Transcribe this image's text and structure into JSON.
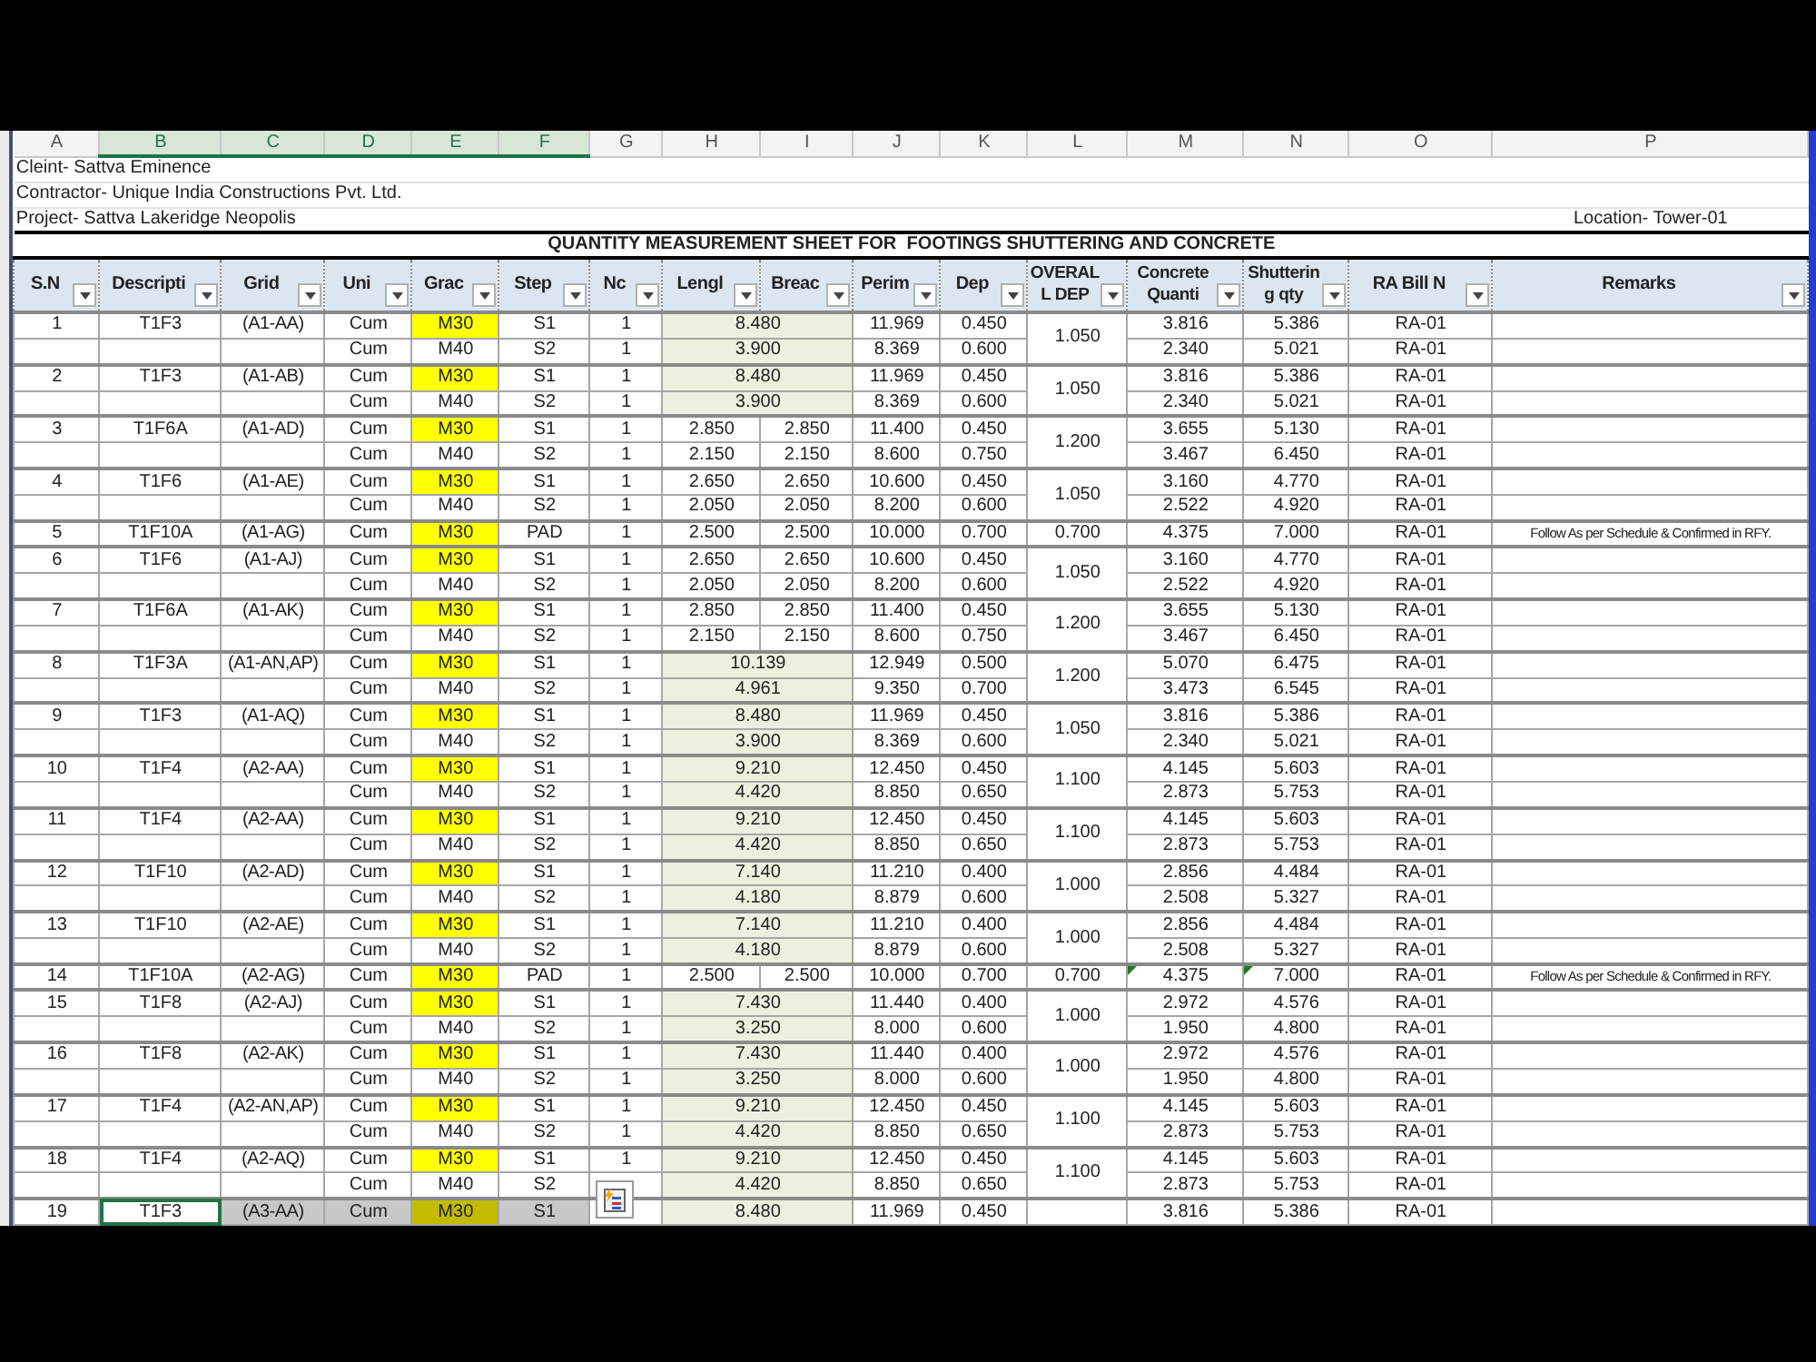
{
  "columns": [
    {
      "letter": "A",
      "selected": false
    },
    {
      "letter": "B",
      "selected": true
    },
    {
      "letter": "C",
      "selected": true
    },
    {
      "letter": "D",
      "selected": true
    },
    {
      "letter": "E",
      "selected": true
    },
    {
      "letter": "F",
      "selected": true
    },
    {
      "letter": "G",
      "selected": false
    },
    {
      "letter": "H",
      "selected": false
    },
    {
      "letter": "I",
      "selected": false
    },
    {
      "letter": "J",
      "selected": false
    },
    {
      "letter": "K",
      "selected": false
    },
    {
      "letter": "L",
      "selected": false
    },
    {
      "letter": "M",
      "selected": false
    },
    {
      "letter": "N",
      "selected": false
    },
    {
      "letter": "O",
      "selected": false
    },
    {
      "letter": "P",
      "selected": false
    }
  ],
  "info_lines": [
    "Cleint- Sattva Eminence",
    "Contractor- Unique India Constructions Pvt. Ltd.",
    "Project- Sattva Lakeridge Neopolis"
  ],
  "location": "Location- Tower-01",
  "sheet_title": "QUANTITY MEASUREMENT SHEET FOR  FOOTINGS SHUTTERING AND CONCRETE",
  "headers": [
    {
      "lines": [
        "S.N"
      ]
    },
    {
      "lines": [
        "Descripti"
      ]
    },
    {
      "lines": [
        "Grid"
      ]
    },
    {
      "lines": [
        "Uni"
      ]
    },
    {
      "lines": [
        "Grac"
      ]
    },
    {
      "lines": [
        "Step"
      ]
    },
    {
      "lines": [
        "Nc"
      ]
    },
    {
      "lines": [
        "Lengl"
      ]
    },
    {
      "lines": [
        "Breac"
      ]
    },
    {
      "lines": [
        "Perim"
      ]
    },
    {
      "lines": [
        "Dep"
      ]
    },
    {
      "lines": [
        "OVERAL",
        "L DEP"
      ]
    },
    {
      "lines": [
        "Concrete",
        "Quanti"
      ]
    },
    {
      "lines": [
        "Shutterin",
        "g qty"
      ]
    },
    {
      "lines": [
        "RA Bill N"
      ]
    },
    {
      "lines": [
        "Remarks"
      ]
    }
  ],
  "footings": [
    {
      "sn": "1",
      "description": "T1F3",
      "grid": "(A1-AA)",
      "overall_depth": "1.050",
      "selected": false,
      "flagged": false,
      "steps": [
        {
          "unit": "Cum",
          "grade": "M30",
          "highlighted": true,
          "step": "S1",
          "nos": "1",
          "length": "8.480",
          "perimeter": "11.969",
          "depth": "0.450",
          "concrete": "3.816",
          "shuttering": "5.386",
          "ra_bill": "RA-01"
        },
        {
          "unit": "Cum",
          "grade": "M40",
          "highlighted": false,
          "step": "S2",
          "nos": "1",
          "length": "3.900",
          "perimeter": "8.369",
          "depth": "0.600",
          "concrete": "2.340",
          "shuttering": "5.021",
          "ra_bill": "RA-01"
        }
      ]
    },
    {
      "sn": "2",
      "description": "T1F3",
      "grid": "(A1-AB)",
      "overall_depth": "1.050",
      "selected": false,
      "flagged": false,
      "steps": [
        {
          "unit": "Cum",
          "grade": "M30",
          "highlighted": true,
          "step": "S1",
          "nos": "1",
          "length": "8.480",
          "perimeter": "11.969",
          "depth": "0.450",
          "concrete": "3.816",
          "shuttering": "5.386",
          "ra_bill": "RA-01"
        },
        {
          "unit": "Cum",
          "grade": "M40",
          "highlighted": false,
          "step": "S2",
          "nos": "1",
          "length": "3.900",
          "perimeter": "8.369",
          "depth": "0.600",
          "concrete": "2.340",
          "shuttering": "5.021",
          "ra_bill": "RA-01"
        }
      ]
    },
    {
      "sn": "3",
      "description": "T1F6A",
      "grid": "(A1-AD)",
      "overall_depth": "1.200",
      "selected": false,
      "flagged": false,
      "steps": [
        {
          "unit": "Cum",
          "grade": "M30",
          "highlighted": true,
          "step": "S1",
          "nos": "1",
          "length": "2.850",
          "breadth": "2.850",
          "perimeter": "11.400",
          "depth": "0.450",
          "concrete": "3.655",
          "shuttering": "5.130",
          "ra_bill": "RA-01"
        },
        {
          "unit": "Cum",
          "grade": "M40",
          "highlighted": false,
          "step": "S2",
          "nos": "1",
          "length": "2.150",
          "breadth": "2.150",
          "perimeter": "8.600",
          "depth": "0.750",
          "concrete": "3.467",
          "shuttering": "6.450",
          "ra_bill": "RA-01"
        }
      ]
    },
    {
      "sn": "4",
      "description": "T1F6",
      "grid": "(A1-AE)",
      "overall_depth": "1.050",
      "selected": false,
      "flagged": false,
      "steps": [
        {
          "unit": "Cum",
          "grade": "M30",
          "highlighted": true,
          "step": "S1",
          "nos": "1",
          "length": "2.650",
          "breadth": "2.650",
          "perimeter": "10.600",
          "depth": "0.450",
          "concrete": "3.160",
          "shuttering": "4.770",
          "ra_bill": "RA-01"
        },
        {
          "unit": "Cum",
          "grade": "M40",
          "highlighted": false,
          "step": "S2",
          "nos": "1",
          "length": "2.050",
          "breadth": "2.050",
          "perimeter": "8.200",
          "depth": "0.600",
          "concrete": "2.522",
          "shuttering": "4.920",
          "ra_bill": "RA-01"
        }
      ]
    },
    {
      "sn": "5",
      "description": "T1F10A",
      "grid": "(A1-AG)",
      "overall_depth": "0.700",
      "selected": false,
      "flagged": false,
      "steps": [
        {
          "unit": "Cum",
          "grade": "M30",
          "highlighted": true,
          "step": "PAD",
          "nos": "1",
          "length": "2.500",
          "breadth": "2.500",
          "perimeter": "10.000",
          "depth": "0.700",
          "concrete": "4.375",
          "shuttering": "7.000",
          "ra_bill": "RA-01",
          "remarks": "Follow As per Schedule & Confirmed in RFY."
        }
      ]
    },
    {
      "sn": "6",
      "description": "T1F6",
      "grid": "(A1-AJ)",
      "overall_depth": "1.050",
      "selected": false,
      "flagged": false,
      "steps": [
        {
          "unit": "Cum",
          "grade": "M30",
          "highlighted": true,
          "step": "S1",
          "nos": "1",
          "length": "2.650",
          "breadth": "2.650",
          "perimeter": "10.600",
          "depth": "0.450",
          "concrete": "3.160",
          "shuttering": "4.770",
          "ra_bill": "RA-01"
        },
        {
          "unit": "Cum",
          "grade": "M40",
          "highlighted": false,
          "step": "S2",
          "nos": "1",
          "length": "2.050",
          "breadth": "2.050",
          "perimeter": "8.200",
          "depth": "0.600",
          "concrete": "2.522",
          "shuttering": "4.920",
          "ra_bill": "RA-01"
        }
      ]
    },
    {
      "sn": "7",
      "description": "T1F6A",
      "grid": "(A1-AK)",
      "overall_depth": "1.200",
      "selected": false,
      "flagged": false,
      "steps": [
        {
          "unit": "Cum",
          "grade": "M30",
          "highlighted": true,
          "step": "S1",
          "nos": "1",
          "length": "2.850",
          "breadth": "2.850",
          "perimeter": "11.400",
          "depth": "0.450",
          "concrete": "3.655",
          "shuttering": "5.130",
          "ra_bill": "RA-01"
        },
        {
          "unit": "Cum",
          "grade": "M40",
          "highlighted": false,
          "step": "S2",
          "nos": "1",
          "length": "2.150",
          "breadth": "2.150",
          "perimeter": "8.600",
          "depth": "0.750",
          "concrete": "3.467",
          "shuttering": "6.450",
          "ra_bill": "RA-01"
        }
      ]
    },
    {
      "sn": "8",
      "description": "T1F3A",
      "grid": "(A1-AN,AP)",
      "overall_depth": "1.200",
      "selected": false,
      "flagged": false,
      "steps": [
        {
          "unit": "Cum",
          "grade": "M30",
          "highlighted": true,
          "step": "S1",
          "nos": "1",
          "length": "10.139",
          "perimeter": "12.949",
          "depth": "0.500",
          "concrete": "5.070",
          "shuttering": "6.475",
          "ra_bill": "RA-01"
        },
        {
          "unit": "Cum",
          "grade": "M40",
          "highlighted": false,
          "step": "S2",
          "nos": "1",
          "length": "4.961",
          "perimeter": "9.350",
          "depth": "0.700",
          "concrete": "3.473",
          "shuttering": "6.545",
          "ra_bill": "RA-01"
        }
      ]
    },
    {
      "sn": "9",
      "description": "T1F3",
      "grid": "(A1-AQ)",
      "overall_depth": "1.050",
      "selected": false,
      "flagged": false,
      "steps": [
        {
          "unit": "Cum",
          "grade": "M30",
          "highlighted": true,
          "step": "S1",
          "nos": "1",
          "length": "8.480",
          "perimeter": "11.969",
          "depth": "0.450",
          "concrete": "3.816",
          "shuttering": "5.386",
          "ra_bill": "RA-01"
        },
        {
          "unit": "Cum",
          "grade": "M40",
          "highlighted": false,
          "step": "S2",
          "nos": "1",
          "length": "3.900",
          "perimeter": "8.369",
          "depth": "0.600",
          "concrete": "2.340",
          "shuttering": "5.021",
          "ra_bill": "RA-01"
        }
      ]
    },
    {
      "sn": "10",
      "description": "T1F4",
      "grid": "(A2-AA)",
      "overall_depth": "1.100",
      "selected": false,
      "flagged": false,
      "steps": [
        {
          "unit": "Cum",
          "grade": "M30",
          "highlighted": true,
          "step": "S1",
          "nos": "1",
          "length": "9.210",
          "perimeter": "12.450",
          "depth": "0.450",
          "concrete": "4.145",
          "shuttering": "5.603",
          "ra_bill": "RA-01"
        },
        {
          "unit": "Cum",
          "grade": "M40",
          "highlighted": false,
          "step": "S2",
          "nos": "1",
          "length": "4.420",
          "perimeter": "8.850",
          "depth": "0.650",
          "concrete": "2.873",
          "shuttering": "5.753",
          "ra_bill": "RA-01"
        }
      ]
    },
    {
      "sn": "11",
      "description": "T1F4",
      "grid": "(A2-AA)",
      "overall_depth": "1.100",
      "selected": false,
      "flagged": false,
      "steps": [
        {
          "unit": "Cum",
          "grade": "M30",
          "highlighted": true,
          "step": "S1",
          "nos": "1",
          "length": "9.210",
          "perimeter": "12.450",
          "depth": "0.450",
          "concrete": "4.145",
          "shuttering": "5.603",
          "ra_bill": "RA-01"
        },
        {
          "unit": "Cum",
          "grade": "M40",
          "highlighted": false,
          "step": "S2",
          "nos": "1",
          "length": "4.420",
          "perimeter": "8.850",
          "depth": "0.650",
          "concrete": "2.873",
          "shuttering": "5.753",
          "ra_bill": "RA-01"
        }
      ]
    },
    {
      "sn": "12",
      "description": "T1F10",
      "grid": "(A2-AD)",
      "overall_depth": "1.000",
      "selected": false,
      "flagged": false,
      "steps": [
        {
          "unit": "Cum",
          "grade": "M30",
          "highlighted": true,
          "step": "S1",
          "nos": "1",
          "length": "7.140",
          "perimeter": "11.210",
          "depth": "0.400",
          "concrete": "2.856",
          "shuttering": "4.484",
          "ra_bill": "RA-01"
        },
        {
          "unit": "Cum",
          "grade": "M40",
          "highlighted": false,
          "step": "S2",
          "nos": "1",
          "length": "4.180",
          "perimeter": "8.879",
          "depth": "0.600",
          "concrete": "2.508",
          "shuttering": "5.327",
          "ra_bill": "RA-01"
        }
      ]
    },
    {
      "sn": "13",
      "description": "T1F10",
      "grid": "(A2-AE)",
      "overall_depth": "1.000",
      "selected": false,
      "flagged": false,
      "steps": [
        {
          "unit": "Cum",
          "grade": "M30",
          "highlighted": true,
          "step": "S1",
          "nos": "1",
          "length": "7.140",
          "perimeter": "11.210",
          "depth": "0.400",
          "concrete": "2.856",
          "shuttering": "4.484",
          "ra_bill": "RA-01"
        },
        {
          "unit": "Cum",
          "grade": "M40",
          "highlighted": false,
          "step": "S2",
          "nos": "1",
          "length": "4.180",
          "perimeter": "8.879",
          "depth": "0.600",
          "concrete": "2.508",
          "shuttering": "5.327",
          "ra_bill": "RA-01"
        }
      ]
    },
    {
      "sn": "14",
      "description": "T1F10A",
      "grid": "(A2-AG)",
      "overall_depth": "0.700",
      "selected": false,
      "flagged": true,
      "steps": [
        {
          "unit": "Cum",
          "grade": "M30",
          "highlighted": true,
          "step": "PAD",
          "nos": "1",
          "length": "2.500",
          "breadth": "2.500",
          "perimeter": "10.000",
          "depth": "0.700",
          "concrete": "4.375",
          "shuttering": "7.000",
          "ra_bill": "RA-01",
          "remarks": "Follow As per Schedule & Confirmed in RFY."
        }
      ]
    },
    {
      "sn": "15",
      "description": "T1F8",
      "grid": "(A2-AJ)",
      "overall_depth": "1.000",
      "selected": false,
      "flagged": false,
      "steps": [
        {
          "unit": "Cum",
          "grade": "M30",
          "highlighted": true,
          "step": "S1",
          "nos": "1",
          "length": "7.430",
          "perimeter": "11.440",
          "depth": "0.400",
          "concrete": "2.972",
          "shuttering": "4.576",
          "ra_bill": "RA-01"
        },
        {
          "unit": "Cum",
          "grade": "M40",
          "highlighted": false,
          "step": "S2",
          "nos": "1",
          "length": "3.250",
          "perimeter": "8.000",
          "depth": "0.600",
          "concrete": "1.950",
          "shuttering": "4.800",
          "ra_bill": "RA-01"
        }
      ]
    },
    {
      "sn": "16",
      "description": "T1F8",
      "grid": "(A2-AK)",
      "overall_depth": "1.000",
      "selected": false,
      "flagged": false,
      "steps": [
        {
          "unit": "Cum",
          "grade": "M30",
          "highlighted": true,
          "step": "S1",
          "nos": "1",
          "length": "7.430",
          "perimeter": "11.440",
          "depth": "0.400",
          "concrete": "2.972",
          "shuttering": "4.576",
          "ra_bill": "RA-01"
        },
        {
          "unit": "Cum",
          "grade": "M40",
          "highlighted": false,
          "step": "S2",
          "nos": "1",
          "length": "3.250",
          "perimeter": "8.000",
          "depth": "0.600",
          "concrete": "1.950",
          "shuttering": "4.800",
          "ra_bill": "RA-01"
        }
      ]
    },
    {
      "sn": "17",
      "description": "T1F4",
      "grid": "(A2-AN,AP)",
      "overall_depth": "1.100",
      "selected": false,
      "flagged": false,
      "steps": [
        {
          "unit": "Cum",
          "grade": "M30",
          "highlighted": true,
          "step": "S1",
          "nos": "1",
          "length": "9.210",
          "perimeter": "12.450",
          "depth": "0.450",
          "concrete": "4.145",
          "shuttering": "5.603",
          "ra_bill": "RA-01"
        },
        {
          "unit": "Cum",
          "grade": "M40",
          "highlighted": false,
          "step": "S2",
          "nos": "1",
          "length": "4.420",
          "perimeter": "8.850",
          "depth": "0.650",
          "concrete": "2.873",
          "shuttering": "5.753",
          "ra_bill": "RA-01"
        }
      ]
    },
    {
      "sn": "18",
      "description": "T1F4",
      "grid": "(A2-AQ)",
      "overall_depth": "1.100",
      "selected": false,
      "flagged": false,
      "steps": [
        {
          "unit": "Cum",
          "grade": "M30",
          "highlighted": true,
          "step": "S1",
          "nos": "1",
          "length": "9.210",
          "perimeter": "12.450",
          "depth": "0.450",
          "concrete": "4.145",
          "shuttering": "5.603",
          "ra_bill": "RA-01"
        },
        {
          "unit": "Cum",
          "grade": "M40",
          "highlighted": false,
          "step": "S2",
          "length": "4.420",
          "perimeter": "8.850",
          "depth": "0.650",
          "concrete": "2.873",
          "shuttering": "5.753",
          "ra_bill": "RA-01"
        }
      ]
    },
    {
      "sn": "19",
      "description": "T1F3",
      "grid": "(A3-AA)",
      "selected": true,
      "flagged": false,
      "steps": [
        {
          "unit": "Cum",
          "grade": "M30",
          "highlighted": true,
          "step": "S1",
          "length": "8.480",
          "perimeter": "11.969",
          "depth": "0.450",
          "concrete": "3.816",
          "shuttering": "5.386",
          "ra_bill": "RA-01"
        }
      ]
    }
  ],
  "paste_options": {
    "shown": true
  }
}
